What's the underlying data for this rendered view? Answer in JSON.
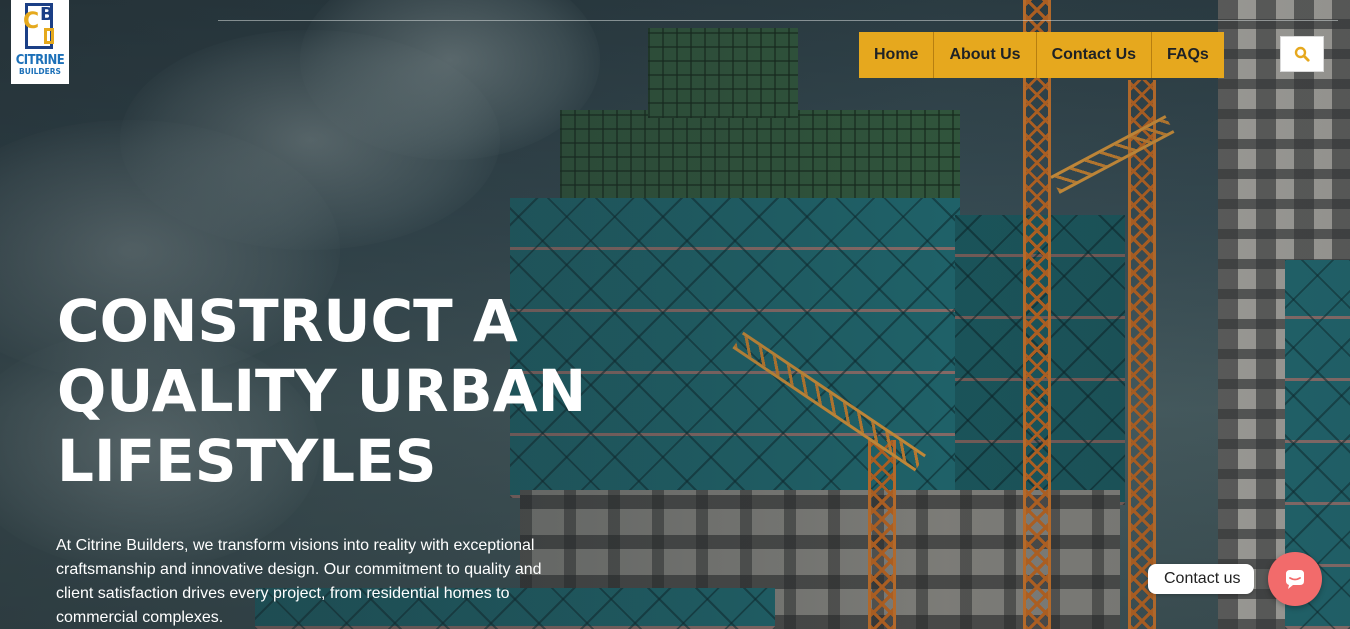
{
  "brand": {
    "name": "CITRINE",
    "sub": "BUILDERS",
    "mark_letters": [
      "C",
      "B"
    ],
    "colors": {
      "navy": "#1b3f86",
      "gold": "#e5a91d",
      "blue": "#1c70b8"
    }
  },
  "nav": {
    "items": [
      {
        "label": "Home"
      },
      {
        "label": "About Us"
      },
      {
        "label": "Contact Us"
      },
      {
        "label": "FAQs"
      }
    ],
    "background": "#e6a81e"
  },
  "search": {
    "icon": "search-icon",
    "color": "#e6a81e"
  },
  "hero": {
    "headline_lines": [
      "CONSTRUCT A",
      "QUALITY URBAN",
      "LIFESTYLES"
    ],
    "paragraph": "At Citrine Builders, we transform visions into reality with exceptional craftsmanship and innovative design. Our commitment to quality and client satisfaction drives every project, from residential homes to commercial complexes."
  },
  "contact_widget": {
    "label": "Contact us",
    "icon": "chat-bubble-icon",
    "color": "#f26b6b"
  }
}
